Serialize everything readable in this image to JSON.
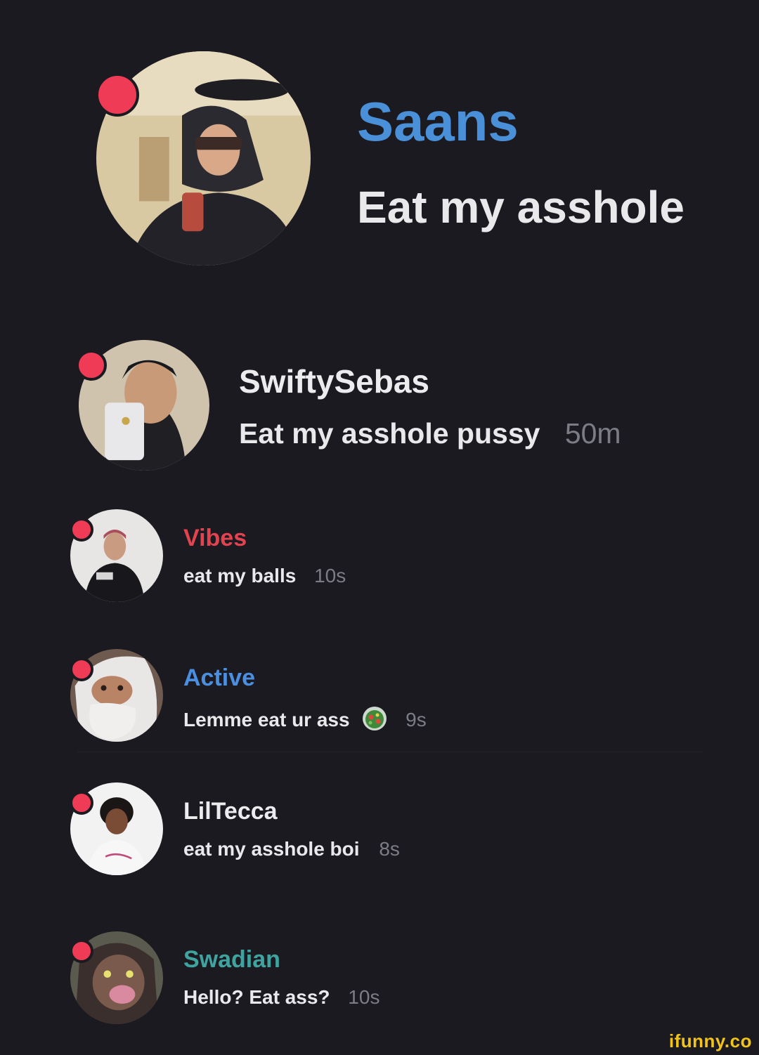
{
  "chats": [
    {
      "name": "Saans",
      "name_color": "#4a90d9",
      "message": "Eat my asshole",
      "time": "",
      "avatar_icon": "user-avatar-photo"
    },
    {
      "name": "SwiftySebas",
      "name_color": "#ececef",
      "message": "Eat my asshole pussy",
      "time": "50m",
      "avatar_icon": "user-avatar-photo"
    },
    {
      "name": "Vibes",
      "name_color": "#e2434f",
      "message": "eat my balls",
      "time": "10s",
      "avatar_icon": "user-avatar-photo"
    },
    {
      "name": "Active",
      "name_color": "#4a8fe0",
      "message": "Lemme eat ur ass",
      "emoji": "salad-emoji",
      "time": "9s",
      "avatar_icon": "user-avatar-photo"
    },
    {
      "name": "LilTecca",
      "name_color": "#ececef",
      "message": "eat my asshole boi",
      "time": "8s",
      "avatar_icon": "user-avatar-photo"
    },
    {
      "name": "Swadian",
      "name_color": "#3fa3a0",
      "message": "Hello? Eat ass?",
      "time": "10s",
      "avatar_icon": "user-avatar-photo"
    }
  ],
  "unread_color": "#ef3b55",
  "watermark": "ifunny.co"
}
